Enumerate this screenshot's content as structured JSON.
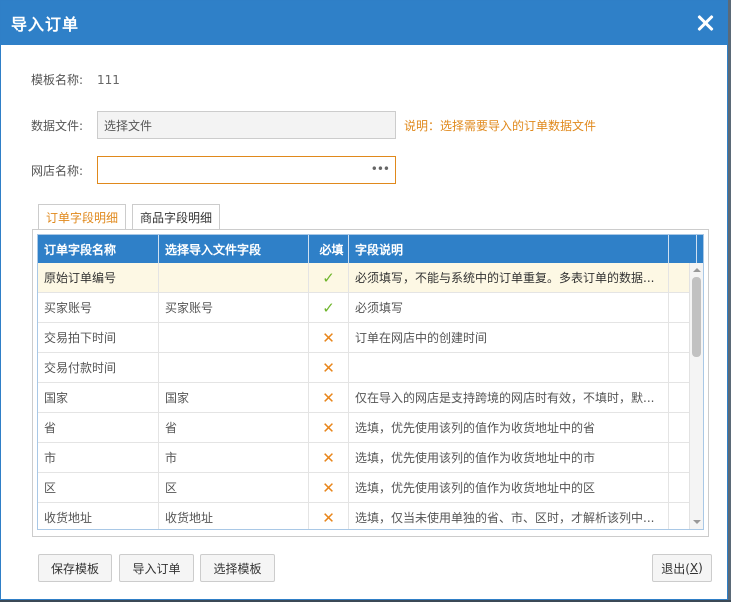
{
  "dialog": {
    "title": "导入订单"
  },
  "form": {
    "template_label": "模板名称:",
    "template_value": "111",
    "file_label": "数据文件:",
    "file_button": "选择文件",
    "file_hint": "说明：选择需要导入的订单数据文件",
    "shop_label": "网店名称:",
    "shop_value": "",
    "shop_more": "•••"
  },
  "tabs": [
    {
      "label": "订单字段明细",
      "active": true
    },
    {
      "label": "商品字段明细",
      "active": false
    }
  ],
  "grid": {
    "headers": [
      "订单字段名称",
      "选择导入文件字段",
      "必填",
      "字段说明"
    ],
    "rows": [
      {
        "name": "原始订单编号",
        "field": "",
        "required": true,
        "desc": "必须填写，不能与系统中的订单重复。多表订单的数据..."
      },
      {
        "name": "买家账号",
        "field": "买家账号",
        "required": true,
        "desc": "必须填写"
      },
      {
        "name": "交易拍下时间",
        "field": "",
        "required": false,
        "desc": "订单在网店中的创建时间"
      },
      {
        "name": "交易付款时间",
        "field": "",
        "required": false,
        "desc": ""
      },
      {
        "name": "国家",
        "field": "国家",
        "required": false,
        "desc": "仅在导入的网店是支持跨境的网店时有效，不填时，默..."
      },
      {
        "name": "省",
        "field": "省",
        "required": false,
        "desc": "选填，优先使用该列的值作为收货地址中的省"
      },
      {
        "name": "市",
        "field": "市",
        "required": false,
        "desc": "选填，优先使用该列的值作为收货地址中的市"
      },
      {
        "name": "区",
        "field": "区",
        "required": false,
        "desc": "选填，优先使用该列的值作为收货地址中的区"
      },
      {
        "name": "收货地址",
        "field": "收货地址",
        "required": false,
        "desc": "选填，仅当未使用单独的省、市、区时，才解析该列中..."
      }
    ],
    "check_glyph": "✓",
    "cross_glyph": "✕"
  },
  "buttons": {
    "save_template": "保存模板",
    "import_order": "导入订单",
    "choose_template": "选择模板",
    "exit_prefix": "退出(",
    "exit_key": "X",
    "exit_suffix": ")"
  },
  "colors": {
    "title_bar": "#2f80c8",
    "accent": "#e0891c",
    "check": "#6fb52c",
    "cross": "#e8851a"
  }
}
